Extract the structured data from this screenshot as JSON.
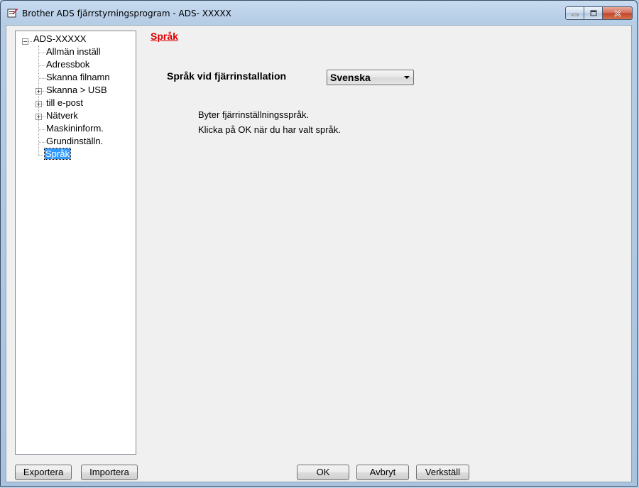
{
  "window": {
    "title": "Brother ADS fjärrstyrningsprogram - ADS- XXXXX",
    "icon": "brother-app-icon",
    "controls": [
      "minimize-icon",
      "maximize-icon",
      "close-icon"
    ]
  },
  "tree": {
    "root": "ADS-XXXXX",
    "items": [
      {
        "label": "Allmän inställ",
        "expandable": false
      },
      {
        "label": "Adressbok",
        "expandable": false
      },
      {
        "label": "Skanna filnamn",
        "expandable": false
      },
      {
        "label": "Skanna > USB",
        "expandable": true
      },
      {
        "label": "till e-post",
        "expandable": true
      },
      {
        "label": "Nätverk",
        "expandable": true
      },
      {
        "label": "Maskininform.",
        "expandable": false
      },
      {
        "label": "Grundinställn.",
        "expandable": false
      },
      {
        "label": "Språk",
        "expandable": false,
        "selected": true
      }
    ]
  },
  "main": {
    "section_title": "Språk",
    "language_label": "Språk vid fjärrinstallation",
    "language_value": "Svenska",
    "info_line1": "Byter fjärrinställningsspråk.",
    "info_line2": "Klicka på OK när du har valt språk."
  },
  "buttons": {
    "export": "Exportera",
    "import": "Importera",
    "ok": "OK",
    "cancel": "Avbryt",
    "apply": "Verkställ"
  },
  "colors": {
    "section_title": "#e00000",
    "selection": "#3399ff"
  }
}
